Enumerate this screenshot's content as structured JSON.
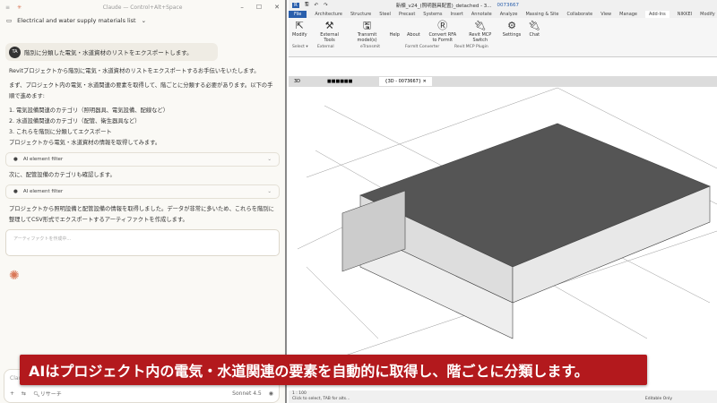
{
  "claude": {
    "window_title": "Claude — Control+Alt+Space",
    "conversation_title": "Electrical and water supply materials list",
    "user": {
      "initials": "TA",
      "message": "階別に分類した電気・水道資材のリストをエクスポートします。"
    },
    "messages": [
      "Revitプロジェクトから階別に電気・水道資材のリストをエクスポートするお手伝いをいたします。",
      "まず、プロジェクト内の電気・水道関連の要素を取得して、階ごとに分類する必要があります。以下の手順で進めます:",
      "1. 電気設備関連のカテゴリ（照明器具、電気設備、配線など）",
      "2. 水道設備関連のカテゴリ（配管、衛生器具など）",
      "3. これらを階別に分類してエクスポート",
      "プロジェクトから電気・水道資材の情報を取得してみます。",
      "次に、配管設備のカテゴリも確認します。",
      "プロジェクトから照明設備と配管設備の情報を取得しました。データが非常に多いため、これらを階別に整理してCSV形式でエクスポートするアーティファクトを作成します。"
    ],
    "tool_calls": [
      "AI element filter",
      "AI element filter"
    ],
    "artifact_placeholder": "アーティファクトを作成中...",
    "composer": {
      "placeholder": "Claude",
      "research": "リサーチ",
      "model": "Sonnet 4.5"
    }
  },
  "revit": {
    "doc_title": "新棟_v24_(照明器具配置)_detached - 3...",
    "user": "0073667",
    "tabs": [
      "File",
      "Architecture",
      "Structure",
      "Steel",
      "Precast",
      "Systems",
      "Insert",
      "Annotate",
      "Analyze",
      "Massing & Site",
      "Collaborate",
      "View",
      "Manage",
      "Add-Ins",
      "NIKKEI",
      "Modify"
    ],
    "active_tab": "Add-Ins",
    "ribbon_buttons": [
      {
        "label": "Modify",
        "icon": "cursor-icon"
      },
      {
        "label": "External Tools",
        "icon": "tools-icon"
      },
      {
        "label": "Transmit model(s)",
        "icon": "save-icon"
      },
      {
        "label": "Help",
        "icon": ""
      },
      {
        "label": "About",
        "icon": ""
      },
      {
        "label": "Convert RFA to FormIt",
        "icon": "formit-icon"
      },
      {
        "label": "Revit MCP Switch",
        "icon": "plug-icon"
      },
      {
        "label": "Settings",
        "icon": "gear-icon"
      },
      {
        "label": "Chat",
        "icon": "plug-icon"
      }
    ],
    "panels": [
      "Select ▾",
      "External",
      "eTransmit",
      "FormIt Converter",
      "Revit MCP Plugin"
    ],
    "view_tabs": [
      "3D",
      "■■■■■■",
      "{3D - 0073667}"
    ],
    "status": {
      "scale": "1 : 100",
      "hint": "Click to select, TAB for alts...",
      "editable": "Editable Only"
    }
  },
  "caption": "AIはプロジェクト内の電気・水道関連の要素を自動的に取得し、階ごとに分類します。"
}
